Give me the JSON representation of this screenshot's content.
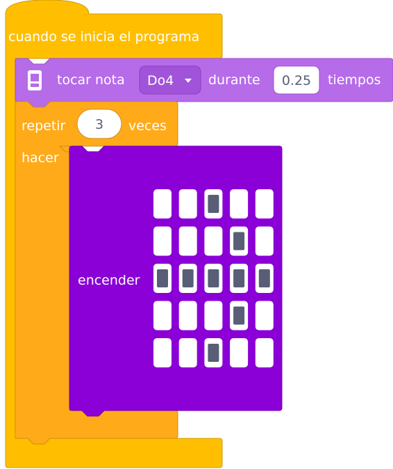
{
  "event_block": {
    "label": "cuando se inicia el programa",
    "color": "#ffbf00"
  },
  "play_block": {
    "label": "tocar nota",
    "note_value": "Do4",
    "during_label": "durante",
    "beats_value": "0.25",
    "beats_unit": "tiempos",
    "color": "#b66be8",
    "icon": "microbit-icon"
  },
  "repeat_block": {
    "label": "repetir",
    "times_value": "3",
    "times_unit": "veces",
    "do_label": "hacer",
    "color": "#ffab19"
  },
  "led_block": {
    "label": "encender",
    "color": "#8a00d6",
    "grid": [
      [
        0,
        0,
        1,
        0,
        0
      ],
      [
        0,
        0,
        0,
        1,
        0
      ],
      [
        1,
        1,
        1,
        1,
        1
      ],
      [
        0,
        0,
        0,
        1,
        0
      ],
      [
        0,
        0,
        1,
        0,
        0
      ]
    ]
  }
}
